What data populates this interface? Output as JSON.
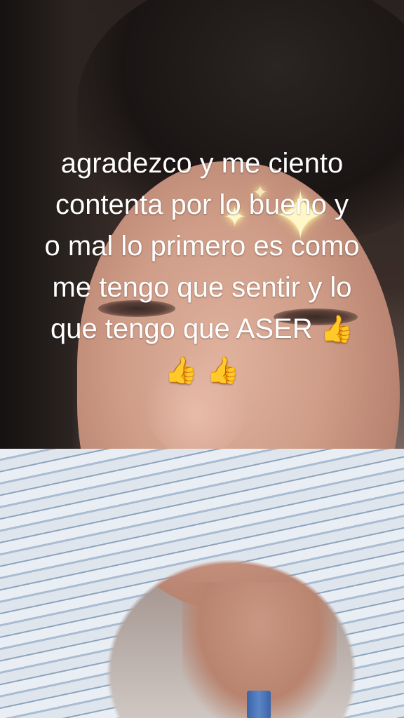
{
  "caption": {
    "lines": [
      "agradezco y me ciento",
      "contenta  por lo bueno y",
      "o mal lo primero es como",
      "me tengo que sentir y lo",
      "que tengo que ASER"
    ],
    "emoji_line_1": "👍",
    "emoji_line_2": "👍 👍"
  },
  "effects": {
    "sparkle_glyph": "✦",
    "sparkle_color": "#fff7c8"
  },
  "icons": {
    "thumbs_up": "thumbs-up-emoji",
    "sparkle": "sparkle-icon"
  }
}
